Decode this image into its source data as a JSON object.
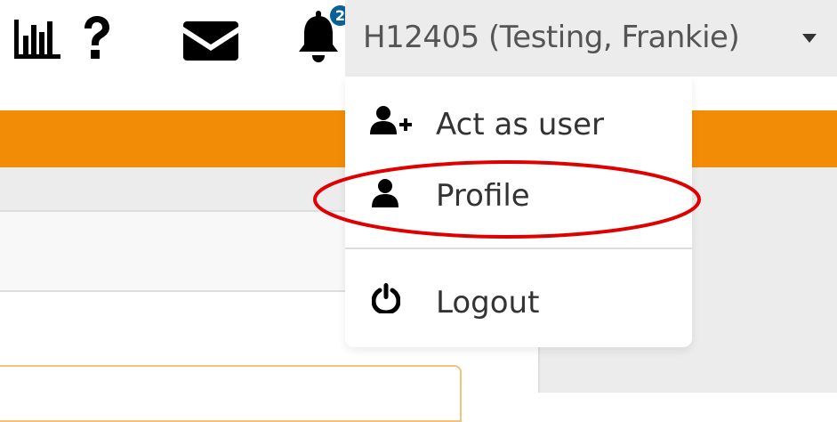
{
  "header": {
    "user_label": "H12405 (Testing, Frankie)",
    "notification_count": "2",
    "icons": [
      "bar-chart-icon",
      "help-icon",
      "envelope-icon",
      "bell-icon",
      "caret-down-icon"
    ]
  },
  "user_menu": {
    "items": [
      {
        "label": "Act as user",
        "icon": "user-plus-icon"
      },
      {
        "label": "Profile",
        "icon": "user-icon",
        "highlighted": true
      },
      {
        "label": "Logout",
        "icon": "power-icon"
      }
    ]
  },
  "colors": {
    "accent_orange": "#f28c07",
    "badge_blue": "#0a5f97",
    "highlight_red": "#e00000",
    "header_grey": "#ececec"
  }
}
